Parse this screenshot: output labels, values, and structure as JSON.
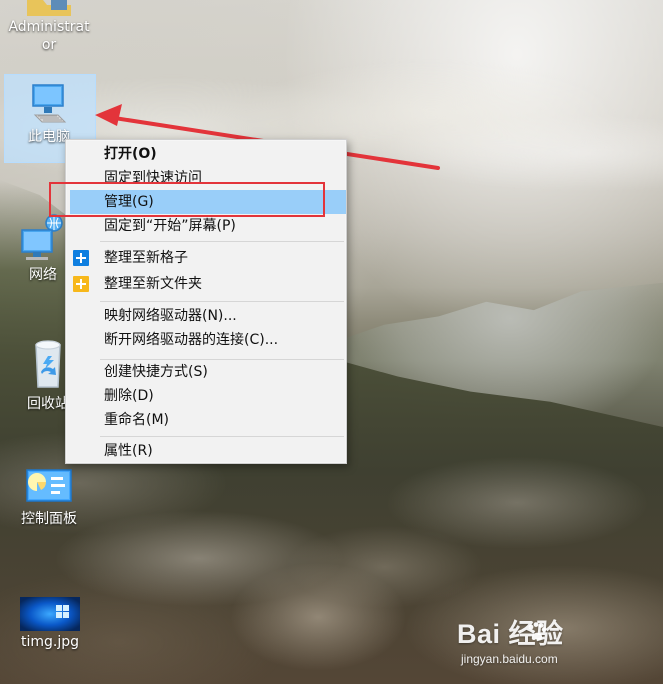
{
  "desktop": {
    "icons": [
      {
        "label": "Administrat\nor",
        "icon": "user-folder-icon"
      },
      {
        "label": "此电脑",
        "icon": "computer-icon"
      },
      {
        "label": "网络",
        "icon": "network-icon"
      },
      {
        "label": "回收站",
        "icon": "recycle-bin-icon"
      },
      {
        "label": "控制面板",
        "icon": "control-panel-icon"
      },
      {
        "label": "timg.jpg",
        "icon": "image-thumbnail-icon"
      }
    ]
  },
  "context_menu": {
    "items": [
      {
        "label": "打开(O)",
        "bold": true
      },
      {
        "label": "固定到快速访问"
      },
      {
        "label": "管理(G)",
        "highlighted": true
      },
      {
        "label": "固定到“开始”屏幕(P)"
      },
      {
        "label": "整理至新格子",
        "icon": "blue-plus-icon"
      },
      {
        "label": "整理至新文件夹",
        "icon": "yellow-folder-plus-icon"
      },
      {
        "label": "映射网络驱动器(N)..."
      },
      {
        "label": "断开网络驱动器的连接(C)..."
      },
      {
        "label": "创建快捷方式(S)"
      },
      {
        "label": "删除(D)"
      },
      {
        "label": "重命名(M)"
      },
      {
        "label": "属性(R)"
      }
    ]
  },
  "annotation": {
    "highlight_color": "#e3343a",
    "arrow_color": "#e3343a"
  },
  "watermark": {
    "brand": "Bai 经验",
    "site": "jingyan.baidu.com"
  }
}
